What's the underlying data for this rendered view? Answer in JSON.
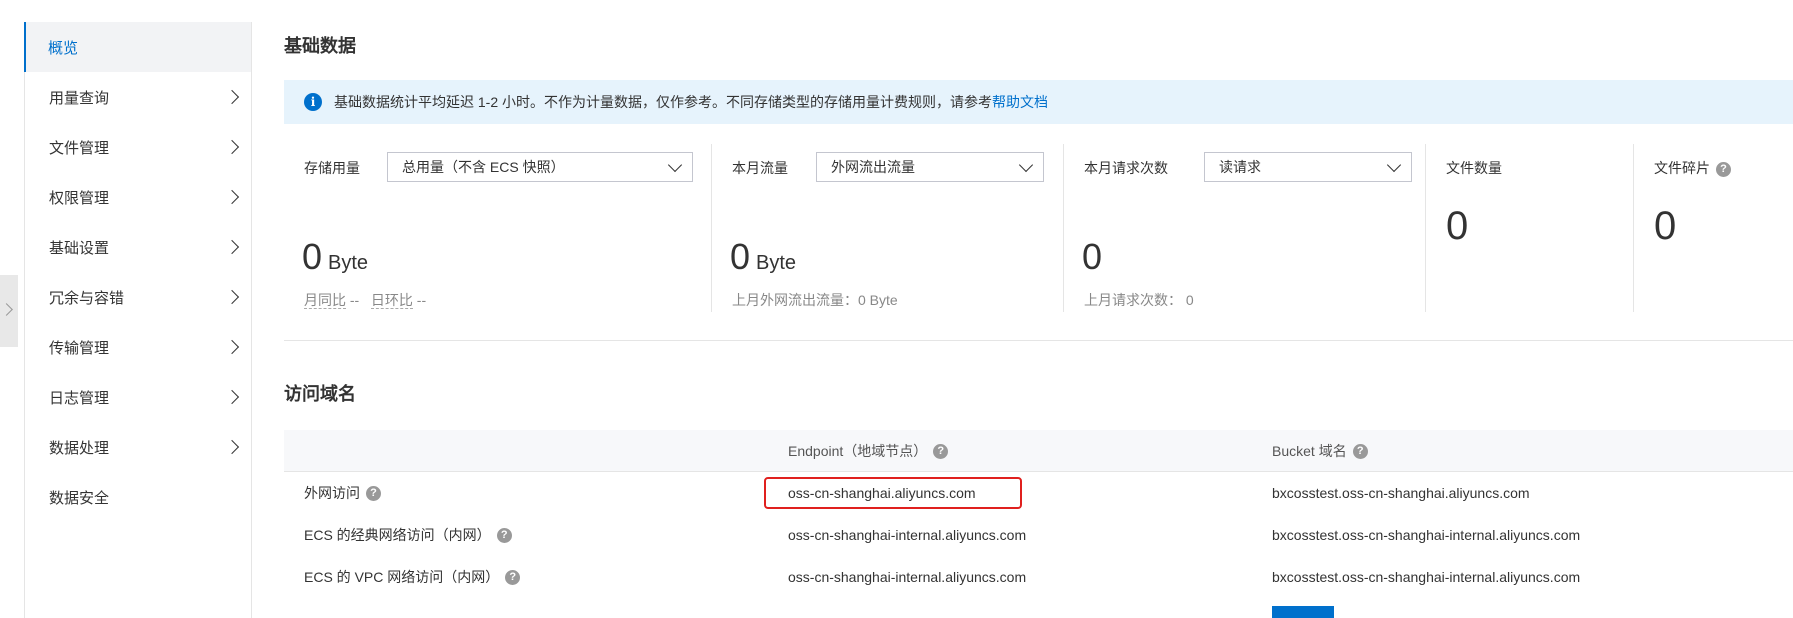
{
  "sidebar": {
    "items": [
      {
        "label": "概览",
        "active": true,
        "has_arrow": false
      },
      {
        "label": "用量查询",
        "has_arrow": true
      },
      {
        "label": "文件管理",
        "has_arrow": true
      },
      {
        "label": "权限管理",
        "has_arrow": true
      },
      {
        "label": "基础设置",
        "has_arrow": true
      },
      {
        "label": "冗余与容错",
        "has_arrow": true
      },
      {
        "label": "传输管理",
        "has_arrow": true
      },
      {
        "label": "日志管理",
        "has_arrow": true
      },
      {
        "label": "数据处理",
        "has_arrow": true
      },
      {
        "label": "数据安全",
        "has_arrow": false
      }
    ]
  },
  "basic": {
    "title": "基础数据",
    "notice_text": "基础数据统计平均延迟 1-2 小时。不作为计量数据，仅作参考。不同存储类型的存储用量计费规则，请参考",
    "notice_link": "帮助文档",
    "storage": {
      "label": "存储用量",
      "select_value": "总用量（不含 ECS 快照）",
      "value": "0",
      "unit": "Byte",
      "mom_label": "月同比",
      "mom_value": "--",
      "dod_label": "日环比",
      "dod_value": "--"
    },
    "traffic": {
      "label": "本月流量",
      "select_value": "外网流出流量",
      "value": "0",
      "unit": "Byte",
      "last_month": "上月外网流出流量：0 Byte"
    },
    "requests": {
      "label": "本月请求次数",
      "select_value": "读请求",
      "value": "0",
      "last_month_label": "上月请求次数：",
      "last_month_value": "0"
    },
    "files": {
      "label": "文件数量",
      "value": "0"
    },
    "fragments": {
      "label": "文件碎片",
      "value": "0"
    }
  },
  "domains": {
    "title": "访问域名",
    "headers": {
      "endpoint": "Endpoint（地域节点）",
      "bucket": "Bucket 域名"
    },
    "rows": [
      {
        "type": "外网访问",
        "endpoint": "oss-cn-shanghai.aliyuncs.com",
        "bucket": "bxcosstest.oss-cn-shanghai.aliyuncs.com"
      },
      {
        "type": "ECS 的经典网络访问（内网）",
        "endpoint": "oss-cn-shanghai-internal.aliyuncs.com",
        "bucket": "bxcosstest.oss-cn-shanghai-internal.aliyuncs.com"
      },
      {
        "type": "ECS 的 VPC 网络访问（内网）",
        "endpoint": "oss-cn-shanghai-internal.aliyuncs.com",
        "bucket": "bxcosstest.oss-cn-shanghai-internal.aliyuncs.com"
      }
    ]
  },
  "colors": {
    "accent": "#0070cc",
    "notice_bg": "#e6f3fc",
    "highlight": "#e0201e"
  }
}
